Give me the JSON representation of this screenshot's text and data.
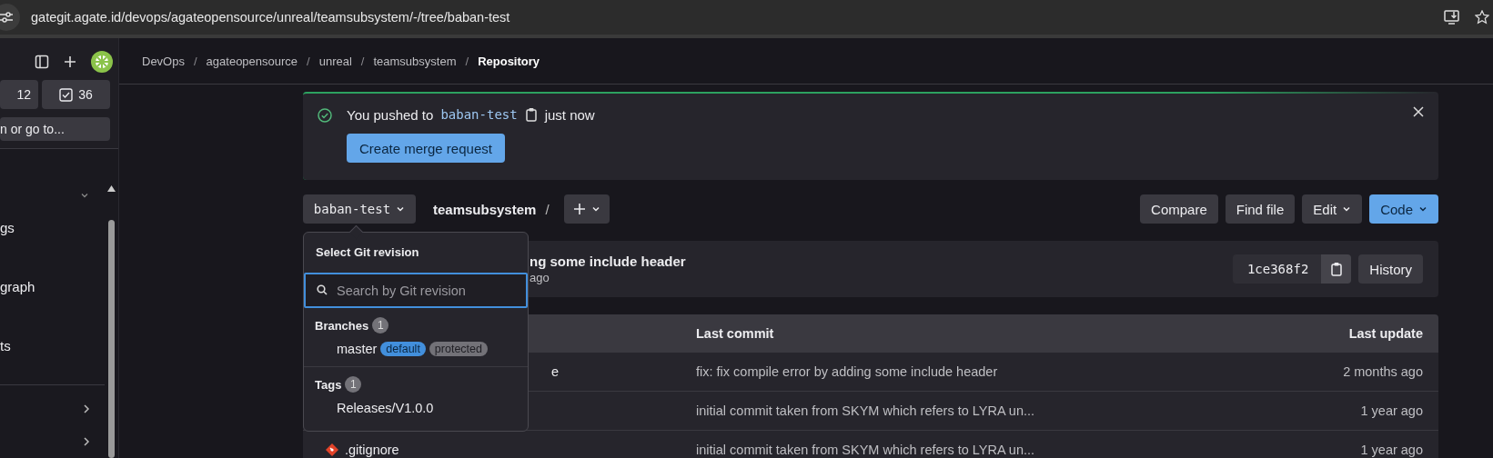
{
  "browser": {
    "url": "gategit.agate.id/devops/agateopensource/unreal/teamsubsystem/-/tree/baban-test"
  },
  "sidebar": {
    "counters": [
      {
        "label": "12",
        "kind": "mr"
      },
      {
        "label": "36",
        "kind": "todo"
      }
    ],
    "search": {
      "placeholder": "n or go to..."
    },
    "items": [
      {
        "label": "gs",
        "kind": "plain"
      },
      {
        "label": "graph",
        "kind": "plain"
      },
      {
        "label": "ts",
        "kind": "plain"
      },
      {
        "kind": "more"
      },
      {
        "kind": "more"
      }
    ]
  },
  "breadcrumbs": {
    "separator": "/",
    "items": [
      {
        "label": "DevOps",
        "current": false
      },
      {
        "label": "agateopensource",
        "current": false
      },
      {
        "label": "unreal",
        "current": false
      },
      {
        "label": "teamsubsystem",
        "current": false
      },
      {
        "label": "Repository",
        "current": true
      }
    ]
  },
  "alert": {
    "prefix": "You pushed to",
    "branch": "baban-test",
    "suffix": "just now",
    "button": "Create merge request"
  },
  "toolbar": {
    "branch": "baban-test",
    "path": "teamsubsystem",
    "separator": "/",
    "actions": [
      {
        "label": "Compare",
        "kind": "default",
        "caret": false
      },
      {
        "label": "Find file",
        "kind": "default",
        "caret": false
      },
      {
        "label": "Edit",
        "kind": "default",
        "caret": true
      },
      {
        "label": "Code",
        "kind": "primary",
        "caret": true
      }
    ]
  },
  "last_commit": {
    "title": "ng some include header",
    "time": "ago",
    "sha": "1ce368f2",
    "history": "History"
  },
  "table": {
    "columns": [
      "Last commit",
      "Last update"
    ],
    "rows": [
      {
        "kind": "partial",
        "name": "e",
        "message": "fix: fix compile error by adding some include header",
        "updated": "2 months ago"
      },
      {
        "kind": "hidden",
        "message": "initial commit taken from SKYM which refers to LYRA un...",
        "updated": "1 year ago"
      },
      {
        "kind": "file",
        "name": ".gitignore",
        "message": "initial commit taken from SKYM which refers to LYRA un...",
        "updated": "1 year ago"
      }
    ]
  },
  "dropdown": {
    "title": "Select Git revision",
    "placeholder": "Search by Git revision",
    "groups": [
      {
        "label": "Branches",
        "count": "1",
        "items": [
          {
            "name": "master",
            "badges": [
              {
                "label": "default",
                "kind": "info"
              },
              {
                "label": "protected",
                "kind": "neutral"
              }
            ]
          }
        ]
      },
      {
        "label": "Tags",
        "count": "1",
        "items": [
          {
            "name": "Releases/V1.0.0"
          }
        ]
      }
    ]
  }
}
